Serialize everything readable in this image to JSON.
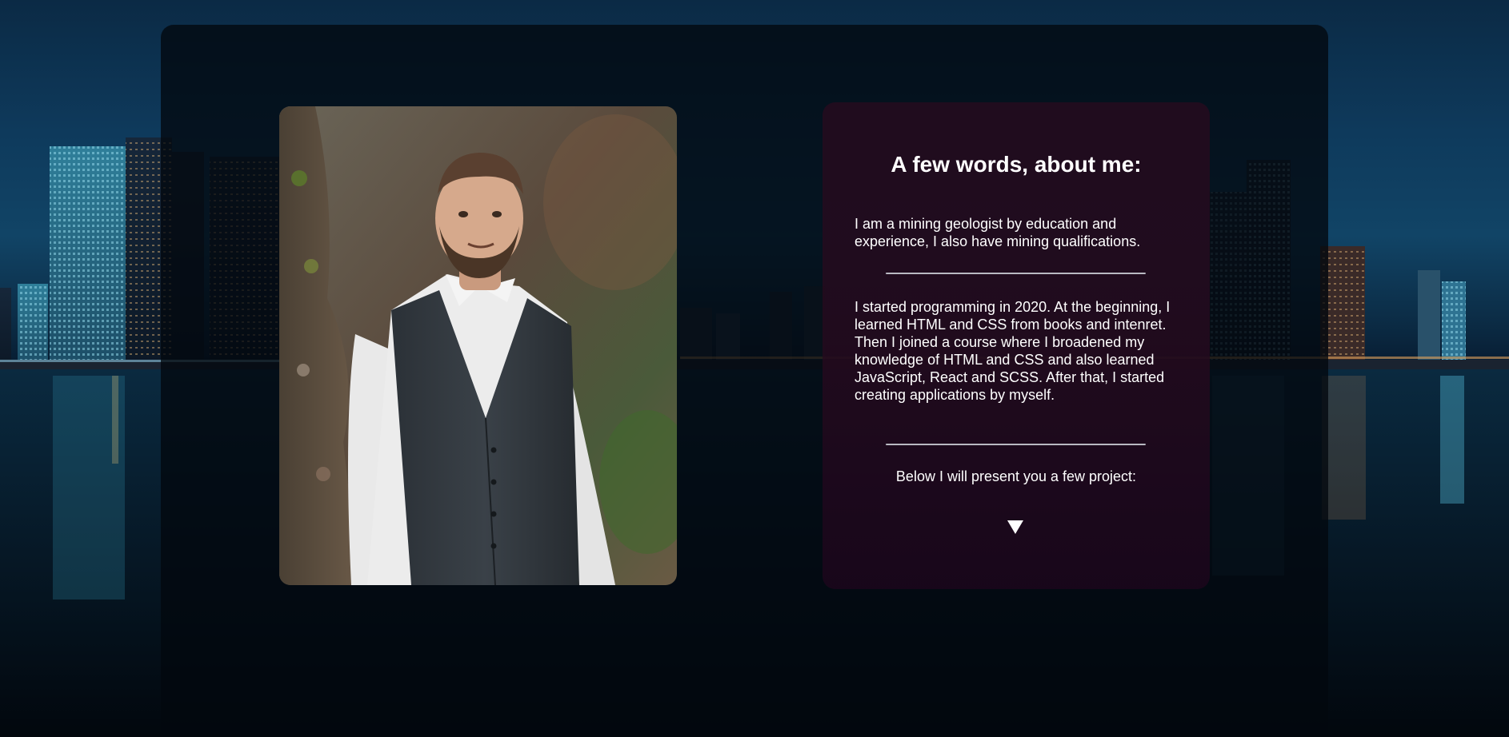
{
  "about": {
    "title": "A few words, about me:",
    "paragraph_1": "I am a mining geologist by education and experience, I also have mining qualifications.",
    "paragraph_2": "I started programming in 2020. At the beginning, I learned HTML and CSS from books and intenret. Then I joined a course where I broadened my knowledge of HTML and CSS and also learned JavaScript, React and SCSS. After that, I started creating applications by myself.",
    "cta": "Below I will present you a few project:",
    "scroll_icon": "down-triangle-icon"
  },
  "photo": {
    "subject": "portrait-photo"
  },
  "background": {
    "scene": "city-skyline-at-night"
  },
  "colors": {
    "panel": "#02080e",
    "card": "#2a0a20",
    "text": "#ffffff",
    "divider": "#b9b9c2"
  }
}
